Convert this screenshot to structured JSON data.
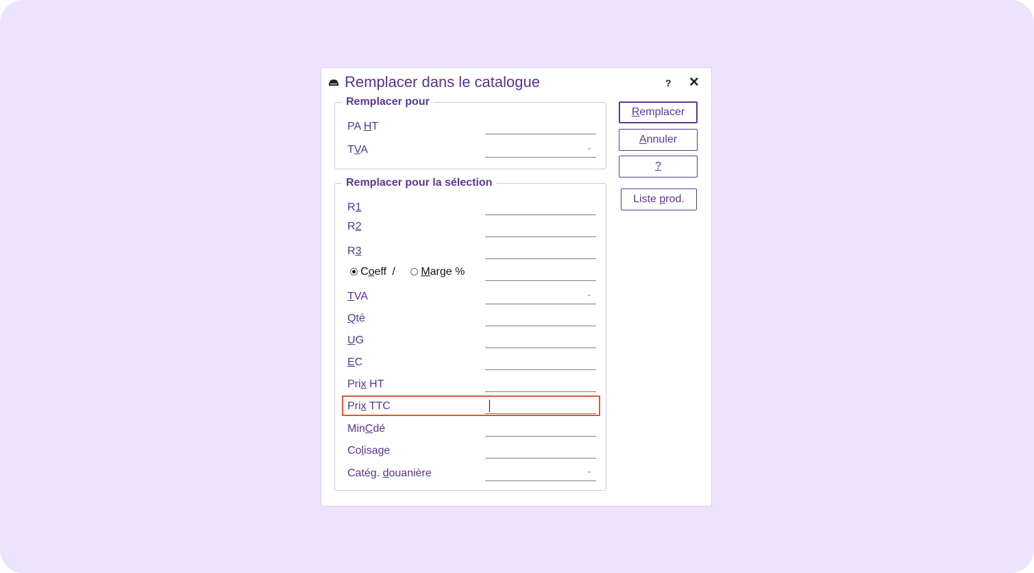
{
  "dialog": {
    "title": "Remplacer dans le catalogue",
    "help_glyph": "?",
    "close_glyph": "✕"
  },
  "group1": {
    "title": "Remplacer pour",
    "fields": [
      {
        "pre": "PA ",
        "acc": "H",
        "post": "T",
        "type": "text",
        "value": ""
      },
      {
        "pre": "T",
        "acc": "V",
        "post": "A",
        "type": "select",
        "value": ""
      }
    ]
  },
  "group2": {
    "title": "Remplacer pour la sélection",
    "fields": [
      {
        "pre": "R",
        "acc": "1",
        "post": "",
        "type": "text",
        "value": ""
      },
      {
        "pre": "R",
        "acc": "2",
        "post": "",
        "type": "text",
        "value": ""
      },
      {
        "pre": "R",
        "acc": "3",
        "post": "",
        "type": "text",
        "value": ""
      },
      {
        "pre": "",
        "acc": "",
        "post": "",
        "type": "radio",
        "value": ""
      },
      {
        "pre": "",
        "acc": "T",
        "post": "VA",
        "type": "select",
        "value": ""
      },
      {
        "pre": "",
        "acc": "Q",
        "post": "té",
        "type": "text",
        "value": ""
      },
      {
        "pre": "",
        "acc": "U",
        "post": "G",
        "type": "text",
        "value": ""
      },
      {
        "pre": "",
        "acc": "E",
        "post": "C",
        "type": "text",
        "value": ""
      },
      {
        "pre": "Pri",
        "acc": "x",
        "post": " HT",
        "type": "text",
        "value": ""
      },
      {
        "pre": "Pri",
        "acc": "x",
        "post": " TTC",
        "type": "text",
        "value": ""
      },
      {
        "pre": "Min",
        "acc": "C",
        "post": "dé",
        "type": "text",
        "value": ""
      },
      {
        "pre": "Co",
        "acc": "l",
        "post": "isage",
        "type": "text",
        "value": ""
      },
      {
        "pre": "Catég. ",
        "acc": "d",
        "post": "ouanière",
        "type": "select",
        "value": ""
      }
    ],
    "radio": {
      "coeff": {
        "pre": "C",
        "acc": "o",
        "post": "eff",
        "checked": true
      },
      "separator": "/",
      "marge": {
        "pre": "",
        "acc": "M",
        "post": "arge %",
        "checked": false
      }
    }
  },
  "buttons": {
    "remplacer": {
      "pre": "",
      "acc": "R",
      "post": "emplacer"
    },
    "annuler": {
      "pre": "",
      "acc": "A",
      "post": "nnuler"
    },
    "help": {
      "pre": "",
      "acc": "?",
      "post": ""
    },
    "liste": {
      "pre": "Liste ",
      "acc": "p",
      "post": "rod."
    }
  },
  "colors": {
    "accent": "#5a3796",
    "highlight": "#e5532f",
    "background": "#ede3fe"
  }
}
